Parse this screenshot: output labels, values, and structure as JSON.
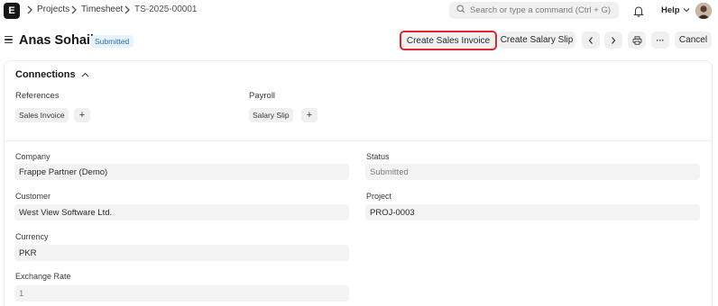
{
  "navbar": {
    "logo_letter": "E",
    "breadcrumbs": [
      "Projects",
      "Timesheet",
      "TS-2025-00001"
    ],
    "search_placeholder": "Search or type a command (Ctrl + G)",
    "help_label": "Help"
  },
  "page": {
    "title": "Anas Sohail",
    "status": "Submitted",
    "actions": {
      "create_sales_invoice": "Create Sales Invoice",
      "create_salary_slip": "Create Salary Slip",
      "more": "···",
      "cancel": "Cancel"
    }
  },
  "connections": {
    "title": "Connections",
    "groups": [
      {
        "title": "References",
        "items": [
          "Sales Invoice"
        ]
      },
      {
        "title": "Payroll",
        "items": [
          "Salary Slip"
        ]
      }
    ],
    "add_label": "+"
  },
  "fields": {
    "company": {
      "label": "Company",
      "value": "Frappe Partner (Demo)"
    },
    "customer": {
      "label": "Customer",
      "value": "West View Software Ltd."
    },
    "currency": {
      "label": "Currency",
      "value": "PKR"
    },
    "exchange_rate": {
      "label": "Exchange Rate",
      "value": "1"
    },
    "status": {
      "label": "Status",
      "value": "Submitted"
    },
    "project": {
      "label": "Project",
      "value": "PROJ-0003"
    }
  },
  "colors": {
    "highlight_border": "#e0262b",
    "status_badge_bg": "#e6f4ff",
    "status_badge_text": "#2c6cb4"
  },
  "icons": [
    "chevron-right-icon",
    "search-icon",
    "bell-icon",
    "chevron-down-icon",
    "hamburger-icon",
    "chevron-up-icon",
    "chevron-left-icon",
    "printer-icon",
    "more-icon",
    "plus-icon"
  ]
}
